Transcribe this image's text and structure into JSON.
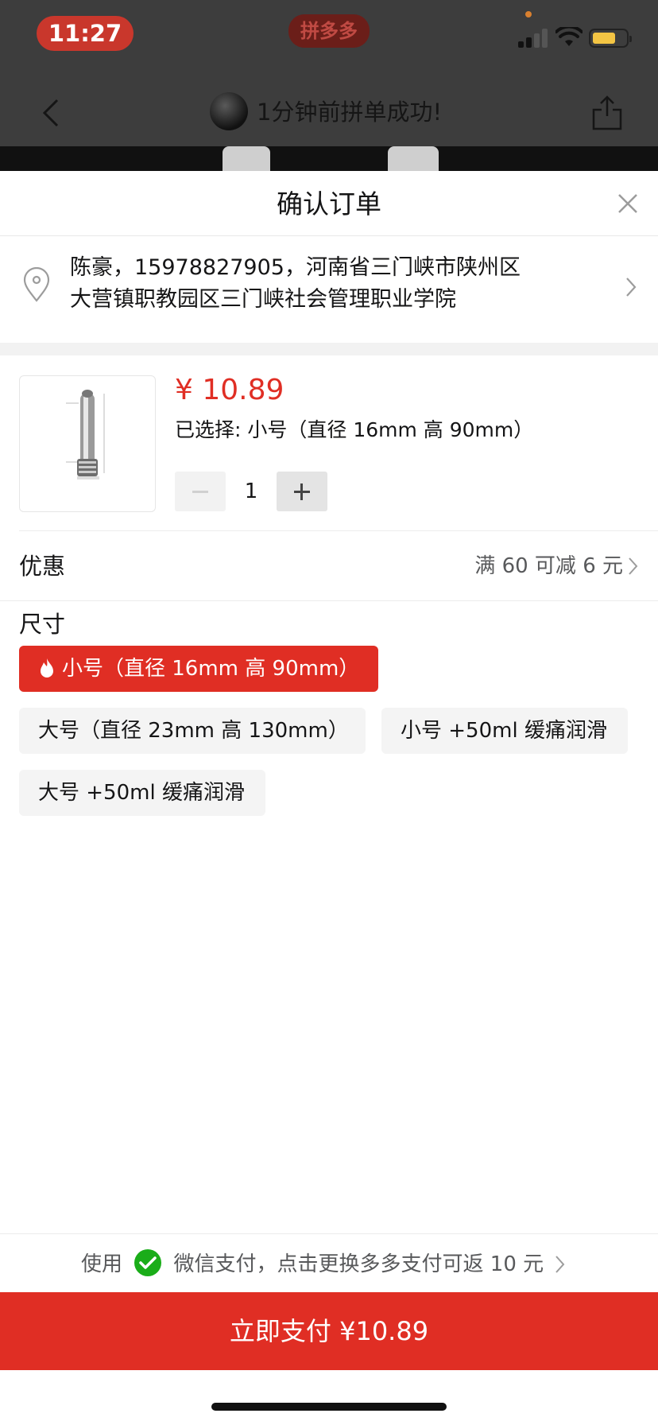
{
  "status_bar": {
    "time": "11:27",
    "brand": "拼多多"
  },
  "navbar": {
    "title": "1分钟前拼单成功!"
  },
  "sheet": {
    "title": "确认订单",
    "address": {
      "line1": "陈豪，15978827905，河南省三门峡市陕州区",
      "line2": "大营镇职教园区三门峡社会管理职业学院"
    },
    "product": {
      "price": "¥ 10.89",
      "selected": "已选择: 小号（直径 16mm 高 90mm）",
      "quantity": "1"
    },
    "discount": {
      "label": "优惠",
      "value": "满 60 可减 6 元"
    },
    "size": {
      "label": "尺寸",
      "options": [
        {
          "label": "小号（直径 16mm 高 90mm）",
          "selected": true
        },
        {
          "label": "大号（直径 23mm 高 130mm）",
          "selected": false
        },
        {
          "label": "小号 +50ml 缓痛润滑",
          "selected": false
        },
        {
          "label": "大号 +50ml 缓痛润滑",
          "selected": false
        }
      ]
    },
    "payment": {
      "prefix": "使用",
      "text": "微信支付，点击更换多多支付可返 10 元",
      "button": "立即支付 ¥10.89"
    }
  },
  "colors": {
    "accent": "#e02e24",
    "wechat": "#1aad19",
    "battery": "#f4c544"
  }
}
